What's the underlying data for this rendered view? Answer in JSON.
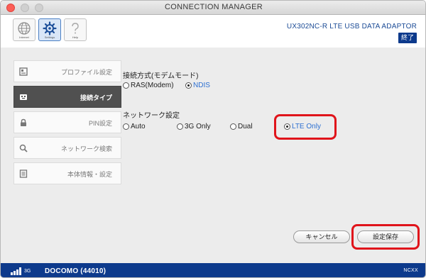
{
  "window": {
    "title": "CONNECTION MANAGER"
  },
  "toolbar": {
    "buttons": [
      {
        "icon": "globe-icon",
        "caption": "Internet"
      },
      {
        "icon": "gear-icon",
        "caption": "Settings"
      },
      {
        "icon": "help-icon",
        "caption": "Help"
      }
    ],
    "device_name": "UX302NC-R LTE USB DATA ADAPTOR",
    "end_label": "終了"
  },
  "sidebar": {
    "items": [
      {
        "icon": "profile-icon",
        "label": "プロファイル設定",
        "active": false
      },
      {
        "icon": "connection-icon",
        "label": "接続タイプ",
        "active": true
      },
      {
        "icon": "lock-icon",
        "label": "PIN設定",
        "active": false
      },
      {
        "icon": "search-icon",
        "label": "ネットワーク検索",
        "active": false
      },
      {
        "icon": "info-icon",
        "label": "本体情報・設定",
        "active": false
      }
    ]
  },
  "connection_mode": {
    "title": "接続方式(モデムモード)",
    "options": [
      {
        "label": "RAS(Modem)",
        "checked": false
      },
      {
        "label": "NDIS",
        "checked": true
      }
    ]
  },
  "network_setting": {
    "title": "ネットワーク設定",
    "options": [
      {
        "label": "Auto",
        "checked": false
      },
      {
        "label": "3G Only",
        "checked": false
      },
      {
        "label": "Dual",
        "checked": false
      },
      {
        "label": "LTE Only",
        "checked": true
      }
    ]
  },
  "actions": {
    "cancel_label": "キャンセル",
    "save_label": "設定保存"
  },
  "statusbar": {
    "network_type": "3G",
    "carrier": "DOCOMO (44010)",
    "brand": "NCXX"
  },
  "colors": {
    "accent": "#0d3a8c",
    "highlight": "#e0141b",
    "selected_text": "#2c6fd1"
  }
}
